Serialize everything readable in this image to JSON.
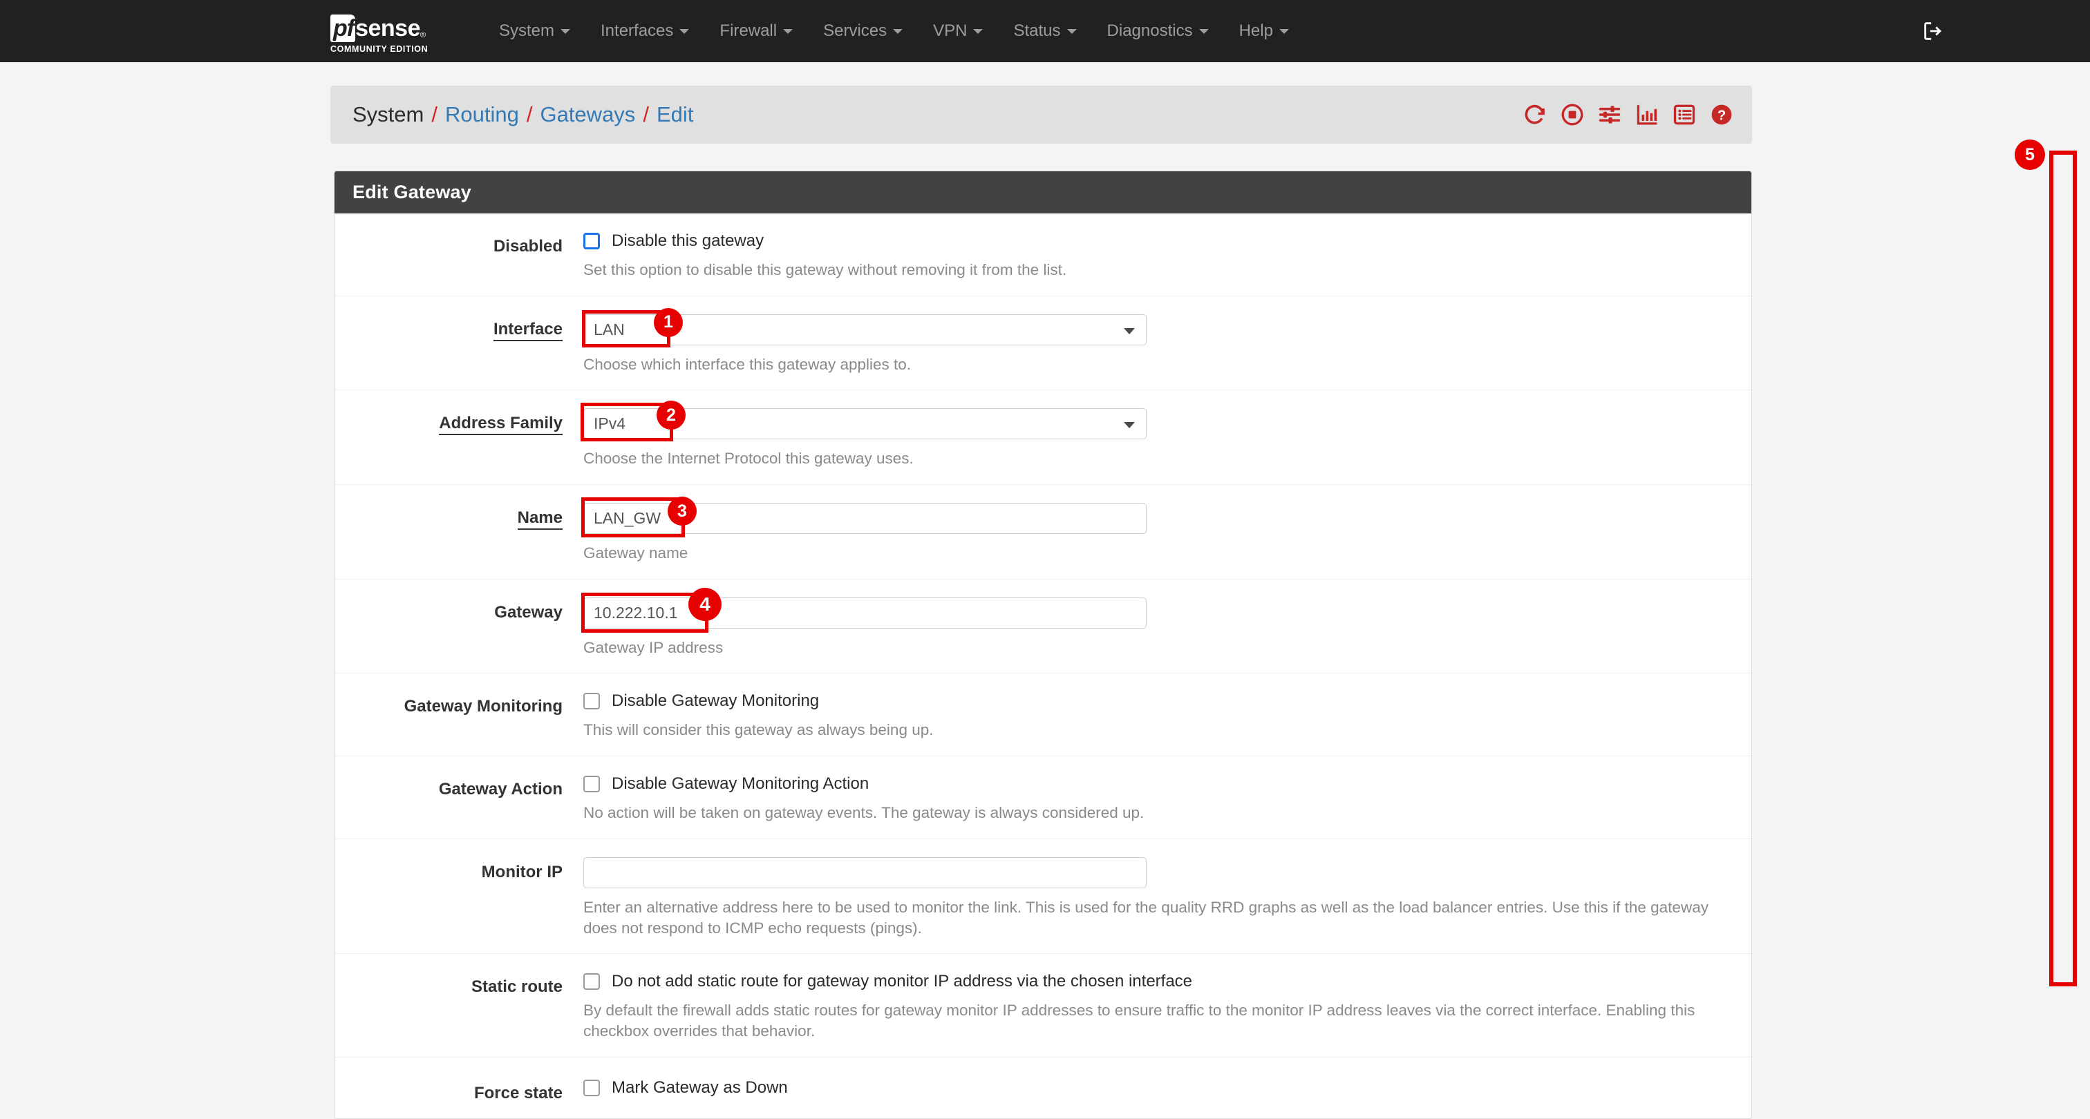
{
  "navbar": {
    "brand": {
      "pf": "pf",
      "sense": "sense",
      "reg": "®",
      "subtitle": "COMMUNITY EDITION"
    },
    "items": [
      {
        "label": "System",
        "has_caret": true
      },
      {
        "label": "Interfaces",
        "has_caret": true
      },
      {
        "label": "Firewall",
        "has_caret": true
      },
      {
        "label": "Services",
        "has_caret": true
      },
      {
        "label": "VPN",
        "has_caret": true
      },
      {
        "label": "Status",
        "has_caret": true
      },
      {
        "label": "Diagnostics",
        "has_caret": true
      },
      {
        "label": "Help",
        "has_caret": true
      }
    ],
    "logout_icon": "logout-icon"
  },
  "breadcrumb": {
    "separator": "/",
    "items": [
      {
        "label": "System",
        "is_link": false
      },
      {
        "label": "Routing",
        "is_link": true
      },
      {
        "label": "Gateways",
        "is_link": true
      },
      {
        "label": "Edit",
        "is_link": true
      }
    ],
    "tools": [
      {
        "name": "restart-refresh-icon"
      },
      {
        "name": "stop-record-icon"
      },
      {
        "name": "sliders-settings-icon"
      },
      {
        "name": "bar-chart-icon"
      },
      {
        "name": "list-view-icon"
      },
      {
        "name": "help-question-icon"
      }
    ]
  },
  "panel": {
    "title": "Edit Gateway",
    "rows": {
      "disabled": {
        "label": "Disabled",
        "checkbox_label": "Disable this gateway",
        "checked": false,
        "focused": true,
        "help": "Set this option to disable this gateway without removing it from the list."
      },
      "interface": {
        "label": "Interface",
        "value": "LAN",
        "help": "Choose which interface this gateway applies to."
      },
      "address_family": {
        "label": "Address Family",
        "value": "IPv4",
        "help": "Choose the Internet Protocol this gateway uses."
      },
      "name": {
        "label": "Name",
        "value": "LAN_GW",
        "help": "Gateway name"
      },
      "gateway": {
        "label": "Gateway",
        "value": "10.222.10.1",
        "help": "Gateway IP address"
      },
      "gateway_monitoring": {
        "label": "Gateway Monitoring",
        "checkbox_label": "Disable Gateway Monitoring",
        "checked": false,
        "help": "This will consider this gateway as always being up."
      },
      "gateway_action": {
        "label": "Gateway Action",
        "checkbox_label": "Disable Gateway Monitoring Action",
        "checked": false,
        "help": "No action will be taken on gateway events. The gateway is always considered up."
      },
      "monitor_ip": {
        "label": "Monitor IP",
        "value": "",
        "placeholder": "",
        "help": "Enter an alternative address here to be used to monitor the link. This is used for the quality RRD graphs as well as the load balancer entries. Use this if the gateway does not respond to ICMP echo requests (pings)."
      },
      "static_route": {
        "label": "Static route",
        "checkbox_label": "Do not add static route for gateway monitor IP address via the chosen interface",
        "checked": false,
        "help": "By default the firewall adds static routes for gateway monitor IP addresses to ensure traffic to the monitor IP address leaves via the correct interface. Enabling this checkbox overrides that behavior."
      },
      "force_state": {
        "label": "Force state",
        "checkbox_label": "Mark Gateway as Down",
        "checked": false
      }
    }
  },
  "annotations": {
    "badges": [
      "1",
      "2",
      "3",
      "4",
      "5"
    ],
    "color": "#e60000"
  }
}
